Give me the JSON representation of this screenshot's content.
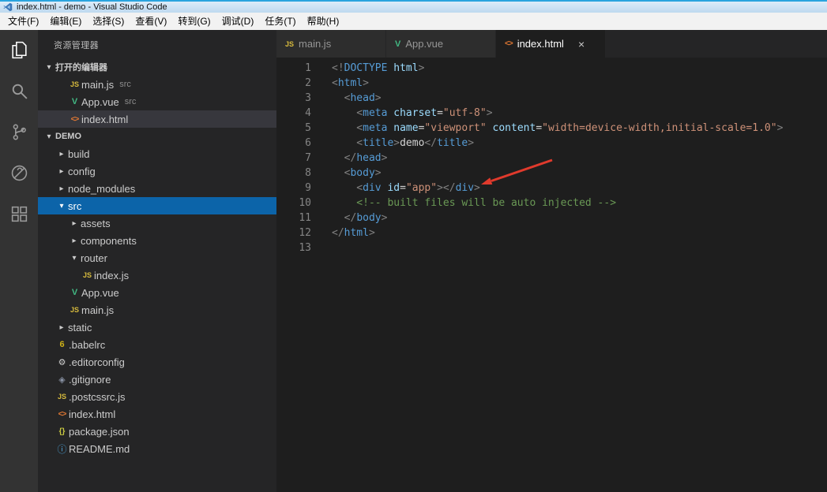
{
  "colors": {
    "annotation": "#e03a2c",
    "selection_blue": "#0c64a9",
    "activity_bar_bg": "#333333",
    "sidebar_bg": "#252526",
    "editor_bg": "#1e1e1e"
  },
  "window": {
    "title": "index.html - demo - Visual Studio Code",
    "menus": [
      "文件(F)",
      "编辑(E)",
      "选择(S)",
      "查看(V)",
      "转到(G)",
      "调试(D)",
      "任务(T)",
      "帮助(H)"
    ]
  },
  "activity_bar": {
    "items": [
      "explorer",
      "search",
      "source-control",
      "debug",
      "extensions"
    ],
    "active": "explorer"
  },
  "icons": {
    "caret_open": "▾",
    "caret_closed": "▸",
    "js": "JS",
    "vue": "V",
    "html": "<>",
    "babel": "6",
    "editorconfig": "⚙",
    "git": "◈",
    "json": "{}",
    "readme": "ⓘ",
    "close": "×"
  },
  "explorer": {
    "title": "资源管理器",
    "open_editors_label": "打开的编辑器",
    "open_editors": [
      {
        "icon": "js",
        "label": "main.js",
        "detail": "src",
        "active": false
      },
      {
        "icon": "vue",
        "label": "App.vue",
        "detail": "src",
        "active": false
      },
      {
        "icon": "html",
        "label": "index.html",
        "detail": "",
        "active": true
      }
    ],
    "root_label": "DEMO",
    "tree": [
      {
        "type": "folder",
        "label": "build",
        "indent": 1,
        "expanded": false
      },
      {
        "type": "folder",
        "label": "config",
        "indent": 1,
        "expanded": false
      },
      {
        "type": "folder",
        "label": "node_modules",
        "indent": 1,
        "expanded": false
      },
      {
        "type": "folder",
        "label": "src",
        "indent": 1,
        "expanded": true,
        "selected": true
      },
      {
        "type": "folder",
        "label": "assets",
        "indent": 2,
        "expanded": false
      },
      {
        "type": "folder",
        "label": "components",
        "indent": 2,
        "expanded": false
      },
      {
        "type": "folder",
        "label": "router",
        "indent": 2,
        "expanded": true
      },
      {
        "type": "file",
        "icon": "js",
        "label": "index.js",
        "indent": 3
      },
      {
        "type": "file",
        "icon": "vue",
        "label": "App.vue",
        "indent": 2
      },
      {
        "type": "file",
        "icon": "js",
        "label": "main.js",
        "indent": 2
      },
      {
        "type": "folder",
        "label": "static",
        "indent": 1,
        "expanded": false
      },
      {
        "type": "file",
        "icon": "babel",
        "label": ".babelrc",
        "indent": 1
      },
      {
        "type": "file",
        "icon": "editorconfig",
        "label": ".editorconfig",
        "indent": 1
      },
      {
        "type": "file",
        "icon": "git",
        "label": ".gitignore",
        "indent": 1
      },
      {
        "type": "file",
        "icon": "js",
        "label": ".postcssrc.js",
        "indent": 1
      },
      {
        "type": "file",
        "icon": "html",
        "label": "index.html",
        "indent": 1
      },
      {
        "type": "file",
        "icon": "json",
        "label": "package.json",
        "indent": 1
      },
      {
        "type": "file",
        "icon": "readme",
        "label": "README.md",
        "indent": 1
      }
    ]
  },
  "tabs": [
    {
      "icon": "js",
      "label": "main.js",
      "active": false
    },
    {
      "icon": "vue",
      "label": "App.vue",
      "active": false
    },
    {
      "icon": "html",
      "label": "index.html",
      "active": true
    }
  ],
  "editor": {
    "lines": [
      {
        "num": 1,
        "tokens": [
          [
            "p",
            "<!"
          ],
          [
            "t",
            "DOCTYPE"
          ],
          [
            "a",
            " html"
          ],
          [
            "p",
            ">"
          ]
        ]
      },
      {
        "num": 2,
        "tokens": [
          [
            "p",
            "<"
          ],
          [
            "t",
            "html"
          ],
          [
            "p",
            ">"
          ]
        ]
      },
      {
        "num": 3,
        "tokens": [
          [
            "p",
            "  <"
          ],
          [
            "t",
            "head"
          ],
          [
            "p",
            ">"
          ]
        ]
      },
      {
        "num": 4,
        "tokens": [
          [
            "p",
            "    <"
          ],
          [
            "t",
            "meta"
          ],
          [
            "a",
            " charset"
          ],
          [
            "o",
            "="
          ],
          [
            "v",
            "\"utf-8\""
          ],
          [
            "p",
            ">"
          ]
        ]
      },
      {
        "num": 5,
        "tokens": [
          [
            "p",
            "    <"
          ],
          [
            "t",
            "meta"
          ],
          [
            "a",
            " name"
          ],
          [
            "o",
            "="
          ],
          [
            "v",
            "\"viewport\""
          ],
          [
            "a",
            " content"
          ],
          [
            "o",
            "="
          ],
          [
            "v",
            "\"width=device-width,initial-scale=1.0\""
          ],
          [
            "p",
            ">"
          ]
        ]
      },
      {
        "num": 6,
        "tokens": [
          [
            "p",
            "    <"
          ],
          [
            "t",
            "title"
          ],
          [
            "p",
            ">"
          ],
          [
            "x",
            "demo"
          ],
          [
            "p",
            "</"
          ],
          [
            "t",
            "title"
          ],
          [
            "p",
            ">"
          ]
        ]
      },
      {
        "num": 7,
        "tokens": [
          [
            "p",
            "  </"
          ],
          [
            "t",
            "head"
          ],
          [
            "p",
            ">"
          ]
        ]
      },
      {
        "num": 8,
        "tokens": [
          [
            "p",
            "  <"
          ],
          [
            "t",
            "body"
          ],
          [
            "p",
            ">"
          ]
        ]
      },
      {
        "num": 9,
        "tokens": [
          [
            "p",
            "    <"
          ],
          [
            "t",
            "div"
          ],
          [
            "a",
            " id"
          ],
          [
            "o",
            "="
          ],
          [
            "v",
            "\"app\""
          ],
          [
            "p",
            ">"
          ],
          [
            "p",
            "</"
          ],
          [
            "t",
            "div"
          ],
          [
            "p",
            ">"
          ]
        ]
      },
      {
        "num": 10,
        "tokens": [
          [
            "c",
            "    <!-- built files will be auto injected -->"
          ]
        ]
      },
      {
        "num": 11,
        "tokens": [
          [
            "p",
            "  </"
          ],
          [
            "t",
            "body"
          ],
          [
            "p",
            ">"
          ]
        ]
      },
      {
        "num": 12,
        "tokens": [
          [
            "p",
            "</"
          ],
          [
            "t",
            "html"
          ],
          [
            "p",
            ">"
          ]
        ]
      },
      {
        "num": 13,
        "tokens": []
      }
    ]
  }
}
